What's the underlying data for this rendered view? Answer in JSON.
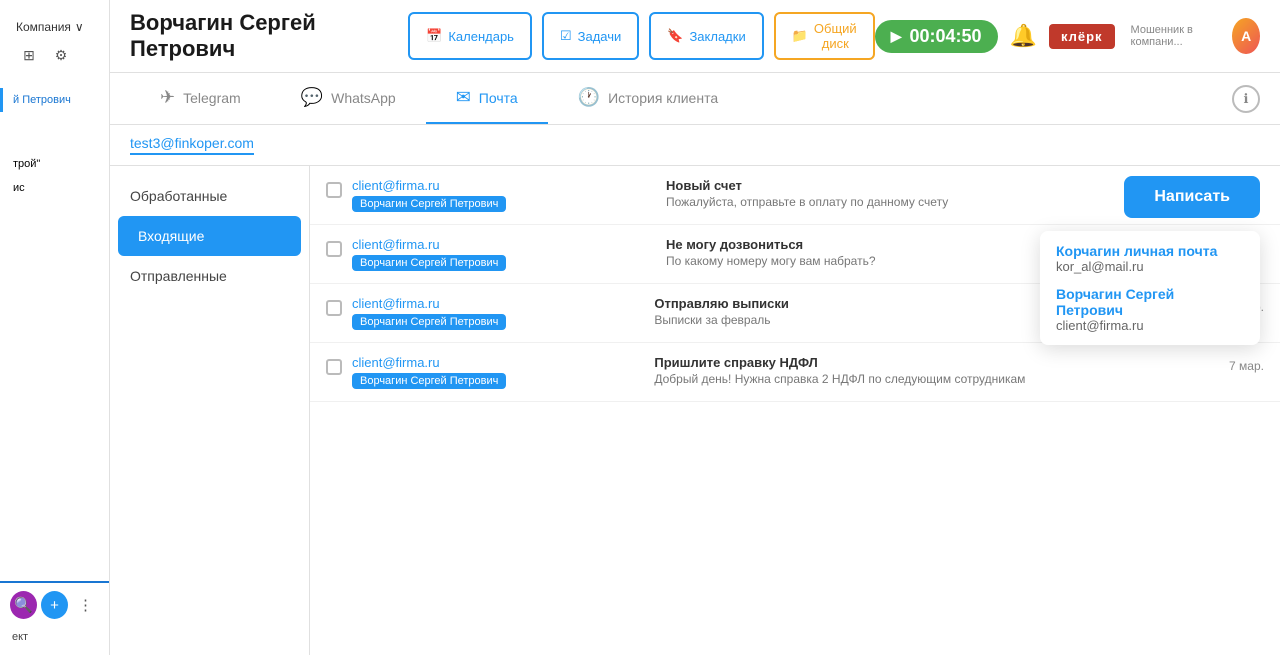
{
  "sidebar": {
    "company_label": "Компания",
    "contact_name": "й Петрович",
    "items": [
      {
        "label": "трой\""
      },
      {
        "label": "ис"
      },
      {
        "label": "ект"
      }
    ],
    "bottom_label": "ект"
  },
  "header": {
    "title": "Ворчагин Сергей Петрович",
    "timer": "00:04:50",
    "klerk_label": "клёрк",
    "fraud_label": "Мошенник в компани...",
    "buttons": [
      {
        "icon": "📅",
        "label": "Календарь"
      },
      {
        "icon": "☑",
        "label": "Задачи"
      },
      {
        "icon": "🔖",
        "label": "Закладки"
      },
      {
        "icon": "📁",
        "label": "Общий диск"
      }
    ]
  },
  "tabs": [
    {
      "icon": "✈",
      "label": "Telegram",
      "active": false
    },
    {
      "icon": "💬",
      "label": "WhatsApp",
      "active": false
    },
    {
      "icon": "✉",
      "label": "Почта",
      "active": true
    },
    {
      "icon": "🕐",
      "label": "История клиента",
      "active": false
    }
  ],
  "email_filter": {
    "address": "test3@finkoper.com"
  },
  "folders": [
    {
      "label": "Обработанные",
      "active": false
    },
    {
      "label": "Входящие",
      "active": true
    },
    {
      "label": "Отправленные",
      "active": false
    }
  ],
  "emails": [
    {
      "from": "client@firma.ru",
      "badge": "Ворчагин Сергей Петрович",
      "subject": "Новый счет",
      "preview": "Пожалуйста, отправьте в оплату по данному счету",
      "date": ""
    },
    {
      "from": "client@firma.ru",
      "badge": "Ворчагин Сергей Петрович",
      "subject": "Не могу дозвониться",
      "preview": "По какому номеру могу вам набрать?",
      "date": ""
    },
    {
      "from": "client@firma.ru",
      "badge": "Ворчагин Сергей Петрович",
      "subject": "Отправляю выписки",
      "preview": "Выписки за февраль",
      "date": "7 мар."
    },
    {
      "from": "client@firma.ru",
      "badge": "Ворчагин Сергей Петрович",
      "subject": "Пришлите справку НДФЛ",
      "preview": "Добрый день! Нужна справка 2 НДФЛ по следующим сотрудникам",
      "date": "7 мар."
    }
  ],
  "write_button": "Написать",
  "dropdown": {
    "items": [
      {
        "name": "Корчагин личная почта",
        "email": "kor_al@mail.ru"
      },
      {
        "name": "Ворчагин Сергей Петрович",
        "email": "client@firma.ru"
      }
    ]
  }
}
